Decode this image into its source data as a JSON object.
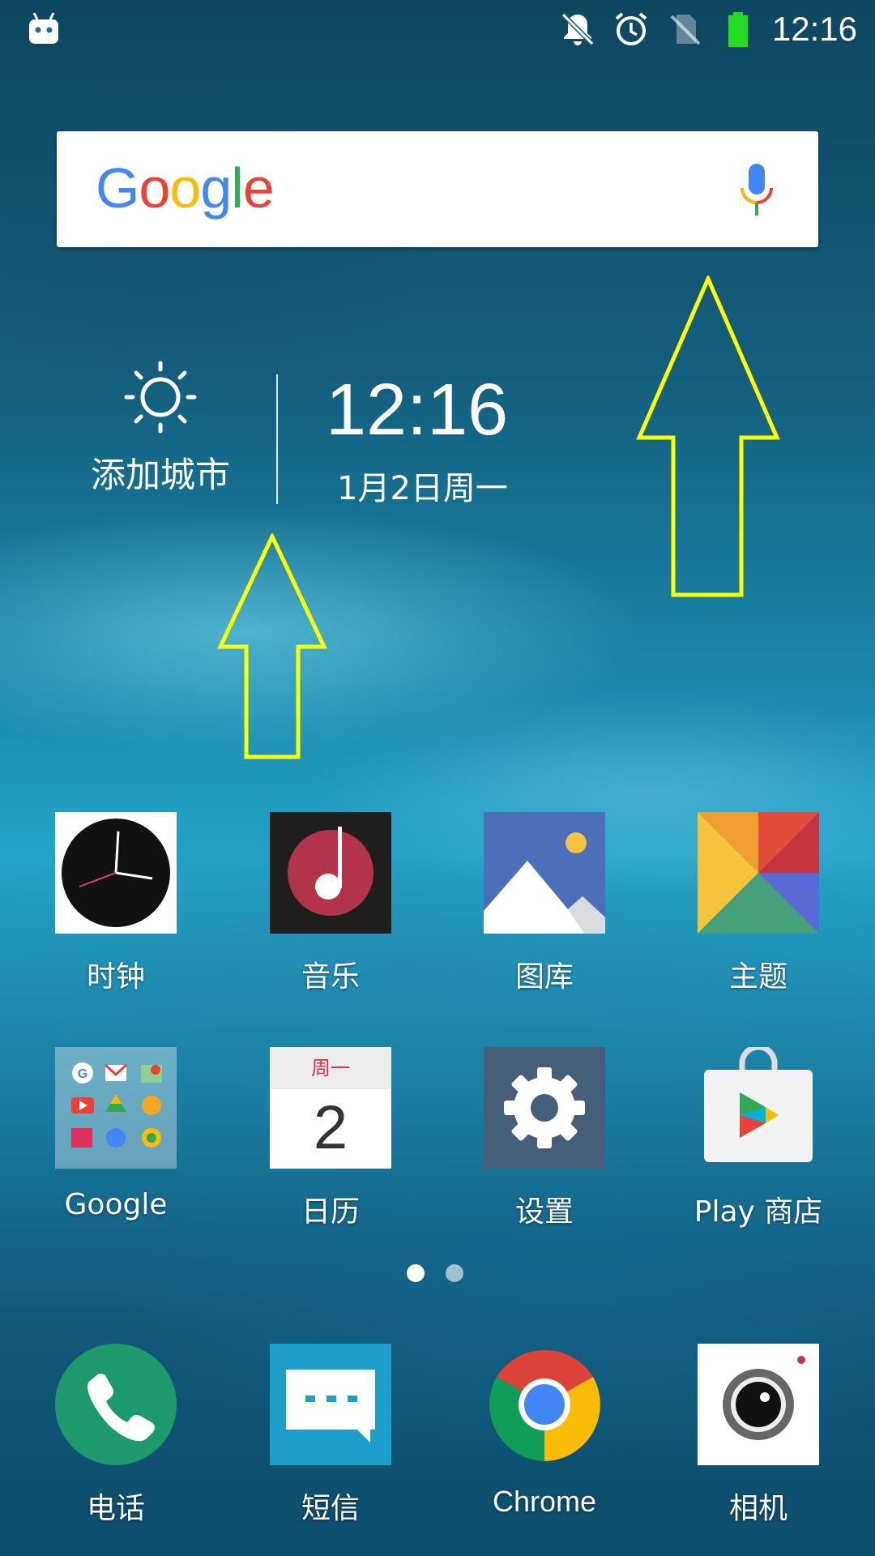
{
  "status_bar": {
    "time": "12:16",
    "icons": [
      "android-icon",
      "bell-off-icon",
      "alarm-icon",
      "no-sim-icon",
      "battery-full-icon"
    ]
  },
  "search_widget": {
    "logo": "Google",
    "logo_colors": [
      "#4285F4",
      "#EA4335",
      "#FBBC05",
      "#4285F4",
      "#34A853",
      "#EA4335"
    ]
  },
  "weather_widget": {
    "label": "添加城市"
  },
  "clock_widget": {
    "time": "12:16",
    "date": "1月2日周一"
  },
  "apps_row1": [
    {
      "label": "时钟",
      "icon": "clock-icon"
    },
    {
      "label": "音乐",
      "icon": "music-icon"
    },
    {
      "label": "图库",
      "icon": "gallery-icon"
    },
    {
      "label": "主题",
      "icon": "theme-icon"
    }
  ],
  "apps_row2": [
    {
      "label": "Google",
      "icon": "google-folder-icon"
    },
    {
      "label": "日历",
      "icon": "calendar-icon",
      "weekday": "周一",
      "day": "2"
    },
    {
      "label": "设置",
      "icon": "settings-icon"
    },
    {
      "label": "Play 商店",
      "icon": "play-store-icon"
    }
  ],
  "dock": [
    {
      "label": "电话",
      "icon": "phone-icon"
    },
    {
      "label": "短信",
      "icon": "messages-icon"
    },
    {
      "label": "Chrome",
      "icon": "chrome-icon"
    },
    {
      "label": "相机",
      "icon": "camera-icon"
    }
  ],
  "page_indicator": {
    "pages": 2,
    "current": 1
  },
  "annotation_color": "#FFFF00"
}
